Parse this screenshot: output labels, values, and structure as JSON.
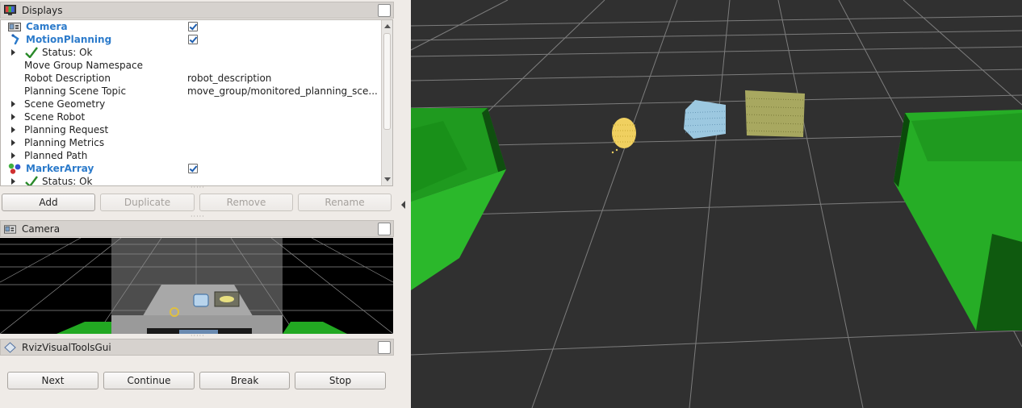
{
  "displays_panel": {
    "title": "Displays",
    "rows": [
      {
        "name": "Camera",
        "checked": true
      },
      {
        "name": "MotionPlanning",
        "checked": true
      },
      {
        "name": "Status: Ok"
      },
      {
        "name": "Move Group Namespace",
        "value": ""
      },
      {
        "name": "Robot Description",
        "value": "robot_description"
      },
      {
        "name": "Planning Scene Topic",
        "value": "move_group/monitored_planning_sce..."
      },
      {
        "name": "Scene Geometry"
      },
      {
        "name": "Scene Robot"
      },
      {
        "name": "Planning Request"
      },
      {
        "name": "Planning Metrics"
      },
      {
        "name": "Planned Path"
      },
      {
        "name": "MarkerArray",
        "checked": true
      },
      {
        "name": "Status: Ok"
      }
    ],
    "buttons": {
      "add": "Add",
      "duplicate": "Duplicate",
      "remove": "Remove",
      "rename": "Rename"
    }
  },
  "camera_panel": {
    "title": "Camera"
  },
  "rviz_tools_panel": {
    "title": "RvizVisualToolsGui",
    "buttons": {
      "next": "Next",
      "continue": "Continue",
      "break": "Break",
      "stop": "Stop"
    }
  },
  "colors": {
    "accent_blue": "#2c7bcb",
    "viewport_bg": "#303030",
    "grid_line": "#8a8a8a",
    "robot_green": "#22a822",
    "cylinder_yellow": "#f0d060",
    "box_blue": "#9cc8e0",
    "box_olive": "#a8a860"
  },
  "icons": {
    "displays": "monitor-icon",
    "camera": "camera-icon",
    "motion_planning": "arm-icon",
    "marker_array": "colored-spheres-icon",
    "status": "checkmark-icon",
    "rviz_tools": "diamond-icon"
  }
}
